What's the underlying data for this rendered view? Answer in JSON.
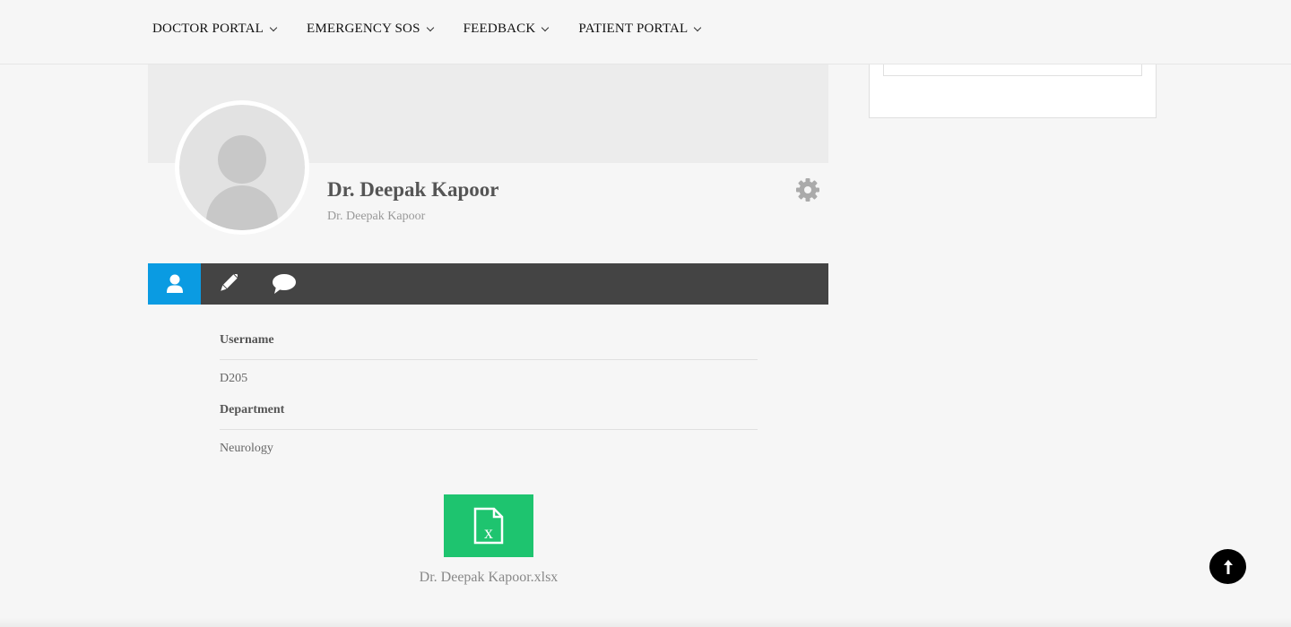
{
  "nav": {
    "items": [
      {
        "label": "DOCTOR PORTAL"
      },
      {
        "label": "EMERGENCY SOS"
      },
      {
        "label": "FEEDBACK"
      },
      {
        "label": "PATIENT PORTAL"
      }
    ]
  },
  "profile": {
    "name": "Dr. Deepak Kapoor",
    "subtitle": "Dr. Deepak Kapoor"
  },
  "tabs": [
    {
      "icon": "user-icon",
      "active": true
    },
    {
      "icon": "pencil-icon",
      "active": false
    },
    {
      "icon": "comment-icon",
      "active": false
    }
  ],
  "fields": [
    {
      "label": "Username",
      "value": "D205"
    },
    {
      "label": "Department",
      "value": "Neurology"
    }
  ],
  "file": {
    "name": "Dr. Deepak Kapoor.xlsx",
    "icon": "excel-file-icon"
  },
  "colors": {
    "active_tab": "#0a9be2",
    "tabbar": "#444444",
    "file_icon": "#1ec46f"
  }
}
